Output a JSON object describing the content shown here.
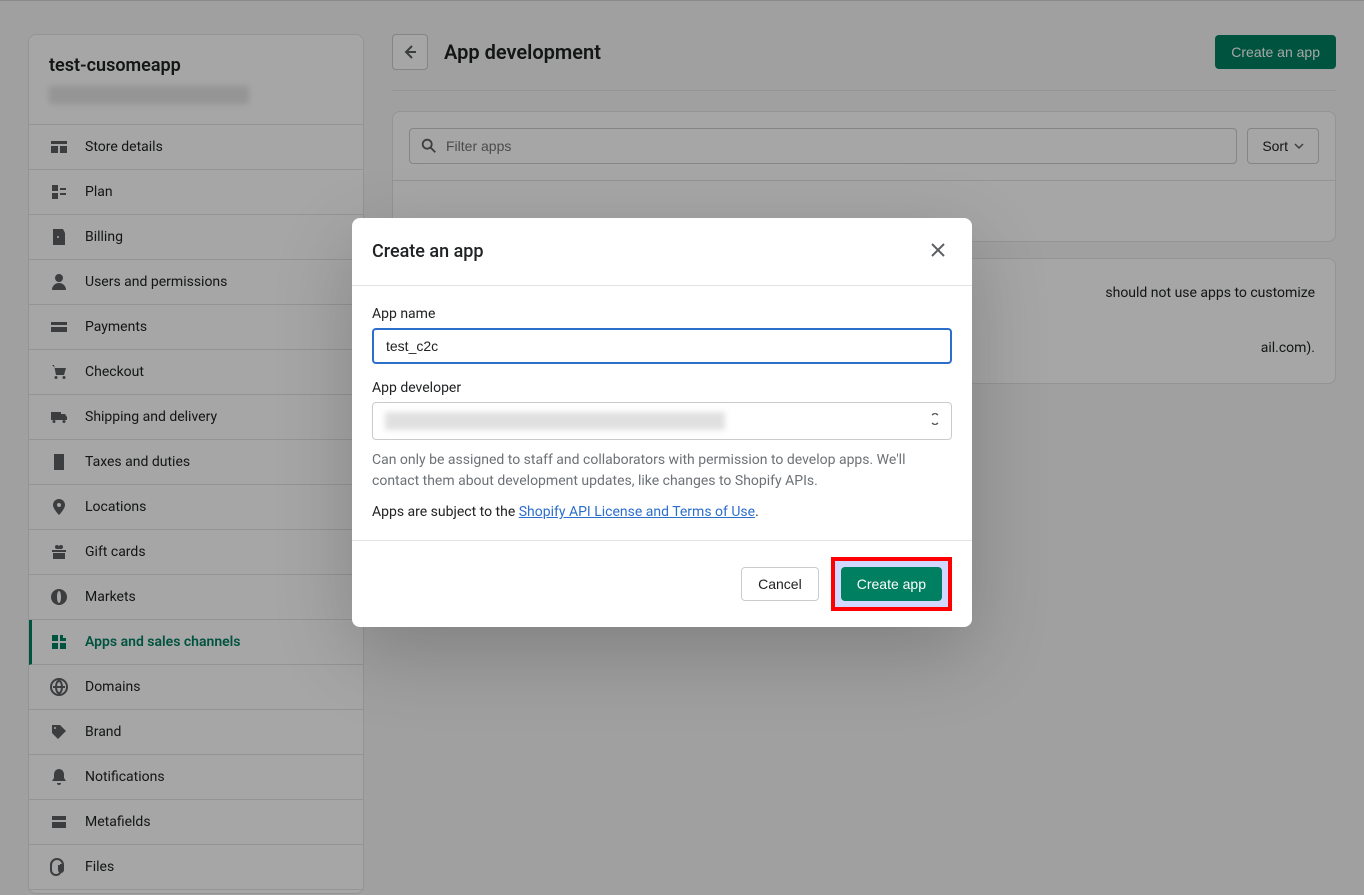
{
  "sidebar": {
    "title": "test-cusomeapp",
    "items": [
      {
        "label": "Store details"
      },
      {
        "label": "Plan"
      },
      {
        "label": "Billing"
      },
      {
        "label": "Users and permissions"
      },
      {
        "label": "Payments"
      },
      {
        "label": "Checkout"
      },
      {
        "label": "Shipping and delivery"
      },
      {
        "label": "Taxes and duties"
      },
      {
        "label": "Locations"
      },
      {
        "label": "Gift cards"
      },
      {
        "label": "Markets"
      },
      {
        "label": "Apps and sales channels"
      },
      {
        "label": "Domains"
      },
      {
        "label": "Brand"
      },
      {
        "label": "Notifications"
      },
      {
        "label": "Metafields"
      },
      {
        "label": "Files"
      }
    ]
  },
  "header": {
    "title": "App development",
    "create_button": "Create an app"
  },
  "filter": {
    "placeholder": "Filter apps",
    "sort_label": "Sort"
  },
  "info_text_partial": "should not use apps to customize",
  "info_text_partial2": "ail.com).",
  "modal": {
    "title": "Create an app",
    "app_name_label": "App name",
    "app_name_value": "test_c2c",
    "developer_label": "App developer",
    "help_text": "Can only be assigned to staff and collaborators with permission to develop apps. We'll contact them about development updates, like changes to Shopify APIs.",
    "consent_prefix": "Apps are subject to the ",
    "consent_link": "Shopify API License and Terms of Use",
    "consent_suffix": ".",
    "cancel_label": "Cancel",
    "create_label": "Create app"
  }
}
